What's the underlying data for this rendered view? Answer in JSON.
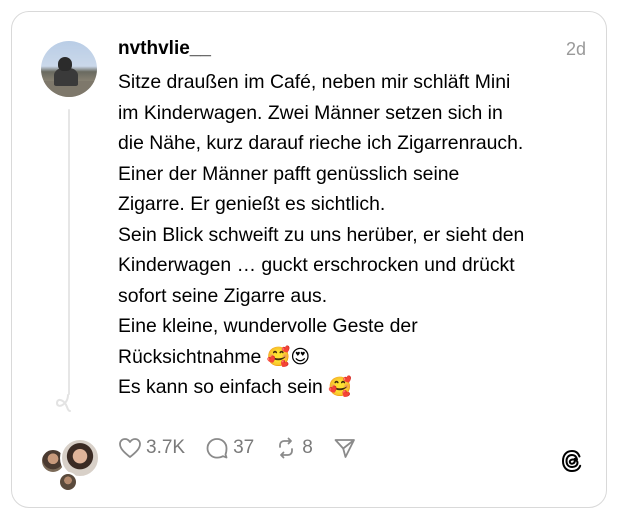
{
  "post": {
    "username": "nvthvlie__",
    "time": "2d",
    "lines": [
      "Sitze draußen im Café, neben mir schläft Mini",
      "im Kinderwagen. Zwei Männer setzen sich in",
      "die Nähe, kurz darauf rieche ich Zigarrenrauch.",
      "Einer der Männer pafft genüsslich seine",
      "Zigarre. Er genießt es sichtlich.",
      "Sein Blick schweift zu uns herüber, er sieht den",
      "Kinderwagen … guckt erschrocken und drückt",
      "sofort seine Zigarre aus.",
      "Eine kleine, wundervolle Geste der",
      "Rücksichtnahme",
      "Es kann so einfach sein"
    ],
    "emoji_line10": "🥰😍",
    "emoji_line11": "🥰"
  },
  "actions": {
    "likes": "3.7K",
    "replies": "37",
    "reposts": "8"
  },
  "icons": [
    "heart-icon",
    "comment-icon",
    "repost-icon",
    "share-icon",
    "threads-logo-icon"
  ],
  "colors": {
    "muted": "#999999",
    "border": "#d9d9d9",
    "line": "#e6e6e6"
  }
}
